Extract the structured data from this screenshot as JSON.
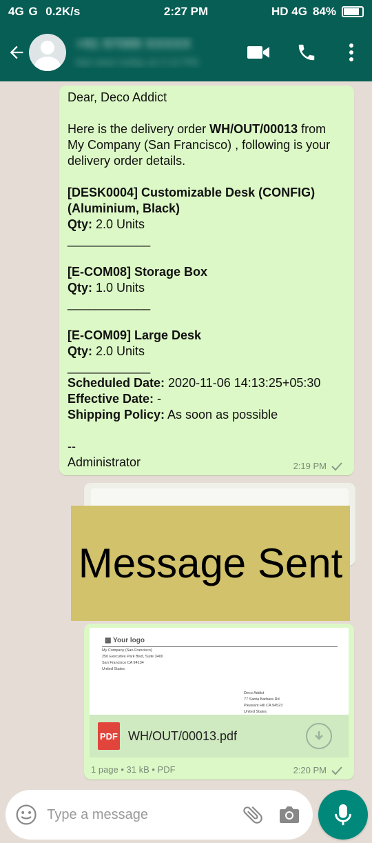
{
  "status_bar": {
    "left": "4G  G   0.2K/s",
    "time": "2:27 PM",
    "right": "HD 4G",
    "battery": "84%",
    "battery_level": 0.84
  },
  "header": {
    "contact_name": "+91 97089 XXXXX",
    "contact_status": "last seen today at 2:12 PM"
  },
  "messages": {
    "m1": {
      "greeting": "Dear, Deco Addict",
      "intro_a": "Here is the delivery order ",
      "order_ref": "WH/OUT/00013",
      "intro_b": " from My Company (San Francisco) , following is your delivery order details.",
      "item1_name": "[DESK0004] Customizable Desk (CONFIG) (Aluminium, Black)",
      "qty_label": "Qty:",
      "item1_qty": " 2.0 Units",
      "sep": "____________",
      "item2_name": "[E-COM08] Storage Box",
      "item2_qty": " 1.0 Units",
      "item3_name": "[E-COM09] Large Desk",
      "item3_qty": " 2.0 Units",
      "scheduled_label": "Scheduled Date:",
      "scheduled_value": " 2020-11-06 14:13:25+05:30",
      "effective_label": "Effective Date:",
      "effective_value": " -",
      "policy_label": "Shipping Policy:",
      "policy_value": " As soon as possible",
      "dash": "--",
      "signature": "Administrator",
      "time": "2:19 PM"
    },
    "banner": "Message Sent",
    "m3": {
      "preview_logo": "Your logo",
      "preview_from": "My Company (San Francisco)\n250 Executive Park Blvd, Suite 3400\nSan Francisco CA 94134\nUnited States",
      "preview_to": "Deco Addict\n77 Santa Barbara Rd\nPleasant Hill CA 94523\nUnited States",
      "pdf_badge": "PDF",
      "file_name": "WH/OUT/00013.pdf",
      "file_meta": "1 page • 31 kB • PDF",
      "time": "2:20 PM"
    }
  },
  "input": {
    "placeholder": "Type a message"
  },
  "colors": {
    "header": "#075e54",
    "bubble_out": "#dcf8c6",
    "banner": "#d1c26b",
    "mic": "#00897b"
  }
}
